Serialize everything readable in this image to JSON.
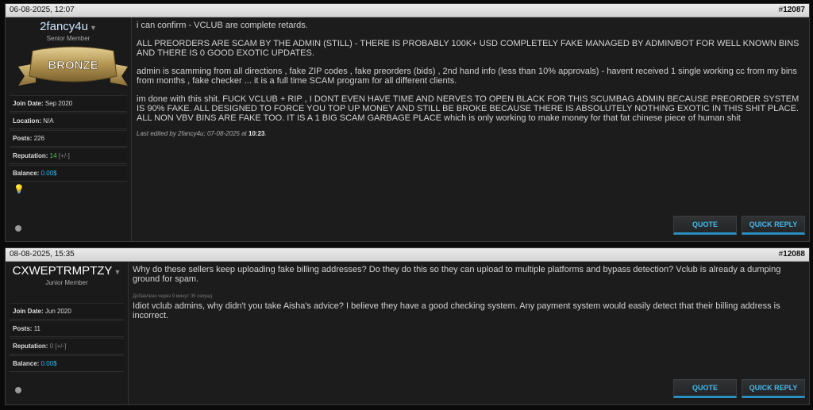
{
  "posts": [
    {
      "date": "06-08-2025, 12:07",
      "number_prefix": "#",
      "number": "12087",
      "username": "2fancy4u",
      "username_color": "#cfe6ff",
      "user_title": "Senior Member",
      "badge_text": "BRONZE",
      "stats": {
        "join_label": "Join Date:",
        "join_value": "Sep 2020",
        "location_label": "Location:",
        "location_value": "N/A",
        "posts_label": "Posts:",
        "posts_value": "226",
        "rep_label": "Reputation:",
        "rep_value": "14",
        "rep_edit": "[+/-]",
        "balance_label": "Balance:",
        "balance_value": "0.00$"
      },
      "paragraphs": [
        "i can confirm - VCLUB are complete retards.",
        "ALL PREORDERS ARE SCAM BY THE ADMIN (STILL) - THERE IS PROBABLY 100K+ USD COMPLETELY FAKE MANAGED BY ADMIN/BOT FOR WELL KNOWN BINS AND THERE IS 0 GOOD EXOTIC UPDATES.",
        "admin is scamming from all directions , fake ZIP codes , fake preorders (bids) , 2nd hand info (less than 10% approvals) - havent received 1 single working cc from my bins from months , fake checker ... it is a full time SCAM program for all different clients.",
        "im done with this shit. FUCK VCLUB + RIP , I DONT EVEN HAVE TIME AND NERVES TO OPEN BLACK FOR THIS SCUMBAG ADMIN BECAUSE PREORDER SYSTEM IS 90% FAKE. ALL DESIGNED TO FORCE YOU TOP UP MONEY AND STILL BE BROKE BECAUSE THERE IS ABSOLUTELY NOTHING EXOTIC IN THIS SHIT PLACE. ALL NON VBV BINS ARE FAKE TOO. IT IS A 1 BIG SCAM GARBAGE PLACE which is only working to make money for that fat chinese piece of human shit"
      ],
      "edited_prefix": "Last edited by 2fancy4u; 07-08-2025 at",
      "edited_time": "10:23",
      "edited_suffix": "."
    },
    {
      "date": "08-08-2025, 15:35",
      "number_prefix": "#",
      "number": "12088",
      "username": "CXWEPTRMPTZY",
      "username_color": "#ffffff",
      "user_title": "Junior Member",
      "stats": {
        "join_label": "Join Date:",
        "join_value": "Jun 2020",
        "posts_label": "Posts:",
        "posts_value": "11",
        "rep_label": "Reputation:",
        "rep_value": "0",
        "rep_edit": "[+/-]",
        "balance_label": "Balance:",
        "balance_value": "0.00$"
      },
      "paragraphs": [
        "Why do these sellers keep uploading fake billing addresses? Do they do this so they can upload to multiple platforms and bypass detection? Vclub is already a dumping ground for spam."
      ],
      "merged_note": "Добавлено через 9 минут 35 секунд",
      "paragraphs_2": [
        "Idiot vclub admins, why didn't you take Aisha's advice? I believe they have a good checking system. Any payment system would easily detect that their billing address is incorrect."
      ]
    }
  ],
  "buttons": {
    "quote": "QUOTE",
    "quick_reply": "QUICK REPLY"
  },
  "icons": {
    "menu_caret": "chevron-down-icon",
    "status": "offline-dot-icon",
    "bulb": "lightbulb-icon"
  },
  "colors": {
    "accent": "#2a8fbf",
    "button_text": "#48b8ea",
    "balance": "#3ab4ff",
    "rep_positive": "#4fc24f"
  }
}
